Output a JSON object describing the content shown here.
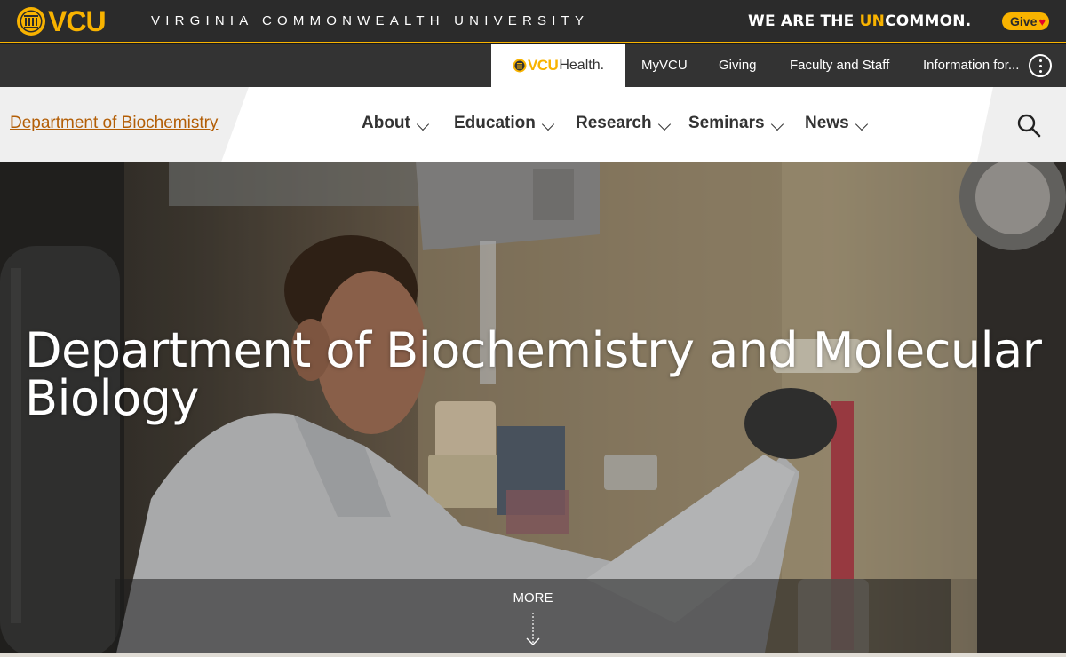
{
  "brand": {
    "logo_text": "VCU",
    "university_name": "VIRGINIA COMMONWEALTH UNIVERSITY",
    "tagline_pre": "WE ARE THE ",
    "tagline_highlight": "UN",
    "tagline_post": "COMMON.",
    "give_label": "Give",
    "accent_color": "#f8b300"
  },
  "utility_nav": {
    "health_logo_vcu": "VCU",
    "health_logo_health": "Health.",
    "items": [
      "MyVCU",
      "Giving",
      "Faculty and Staff",
      "Information for..."
    ]
  },
  "department": {
    "name": "Department of Biochemistry",
    "link_color": "#b35e06"
  },
  "main_nav": {
    "items": [
      "About",
      "Education",
      "Research",
      "Seminars",
      "News"
    ]
  },
  "hero": {
    "title": "Department of Biochemistry and Molecular Biology",
    "more_label": "MORE"
  },
  "icons": {
    "search": "search-icon",
    "info": "more-options-icon",
    "chevron": "chevron-down-icon",
    "heart": "heart-icon",
    "arrow": "arrow-down-icon"
  }
}
